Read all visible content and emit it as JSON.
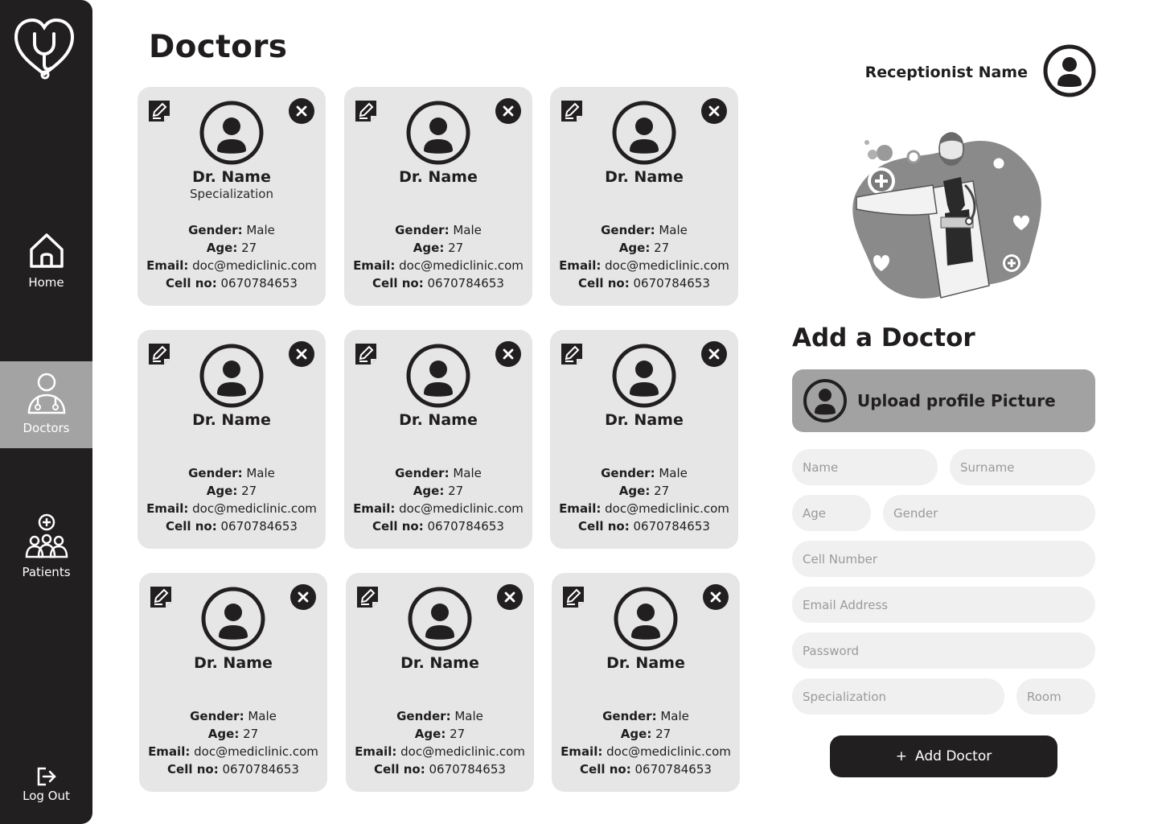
{
  "sidebar": {
    "logo_icon": "heart-stethoscope-icon",
    "items": [
      {
        "label": "Home",
        "icon": "home-icon"
      },
      {
        "label": "Doctors",
        "icon": "doctor-icon",
        "active": true
      },
      {
        "label": "Patients",
        "icon": "patients-icon"
      }
    ],
    "logout_label": "Log Out"
  },
  "page_title": "Doctors",
  "header": {
    "receptionist_name": "Receptionist Name"
  },
  "labels": {
    "gender": "Gender:",
    "age": "Age:",
    "email": "Email:",
    "cell": "Cell no:"
  },
  "doctors": [
    {
      "name": "Dr. Name",
      "specialization": "Specialization",
      "gender": "Male",
      "age": "27",
      "email": "doc@mediclinic.com",
      "cell": "0670784653"
    },
    {
      "name": "Dr. Name",
      "specialization": "",
      "gender": "Male",
      "age": "27",
      "email": "doc@mediclinic.com",
      "cell": "0670784653"
    },
    {
      "name": "Dr. Name",
      "specialization": "",
      "gender": "Male",
      "age": "27",
      "email": "doc@mediclinic.com",
      "cell": "0670784653"
    },
    {
      "name": "Dr. Name",
      "specialization": "",
      "gender": "Male",
      "age": "27",
      "email": "doc@mediclinic.com",
      "cell": "0670784653"
    },
    {
      "name": "Dr. Name",
      "specialization": "",
      "gender": "Male",
      "age": "27",
      "email": "doc@mediclinic.com",
      "cell": "0670784653"
    },
    {
      "name": "Dr. Name",
      "specialization": "",
      "gender": "Male",
      "age": "27",
      "email": "doc@mediclinic.com",
      "cell": "0670784653"
    },
    {
      "name": "Dr. Name",
      "specialization": "",
      "gender": "Male",
      "age": "27",
      "email": "doc@mediclinic.com",
      "cell": "0670784653"
    },
    {
      "name": "Dr. Name",
      "specialization": "",
      "gender": "Male",
      "age": "27",
      "email": "doc@mediclinic.com",
      "cell": "0670784653"
    },
    {
      "name": "Dr. Name",
      "specialization": "",
      "gender": "Male",
      "age": "27",
      "email": "doc@mediclinic.com",
      "cell": "0670784653"
    }
  ],
  "form": {
    "title": "Add a Doctor",
    "upload_label": "Upload profile Picture",
    "placeholders": {
      "name": "Name",
      "surname": "Surname",
      "age": "Age",
      "gender": "Gender",
      "cell": "Cell Number",
      "email": "Email Address",
      "password": "Password",
      "specialization": "Specialization",
      "room": "Room"
    },
    "submit_icon": "+",
    "submit_label": "Add Doctor"
  },
  "colors": {
    "sidebar": "#221f20",
    "active_nav": "#a3a3a3",
    "card": "#e6e6e6",
    "field": "#f0f0f0",
    "upload": "#a2a2a2"
  }
}
